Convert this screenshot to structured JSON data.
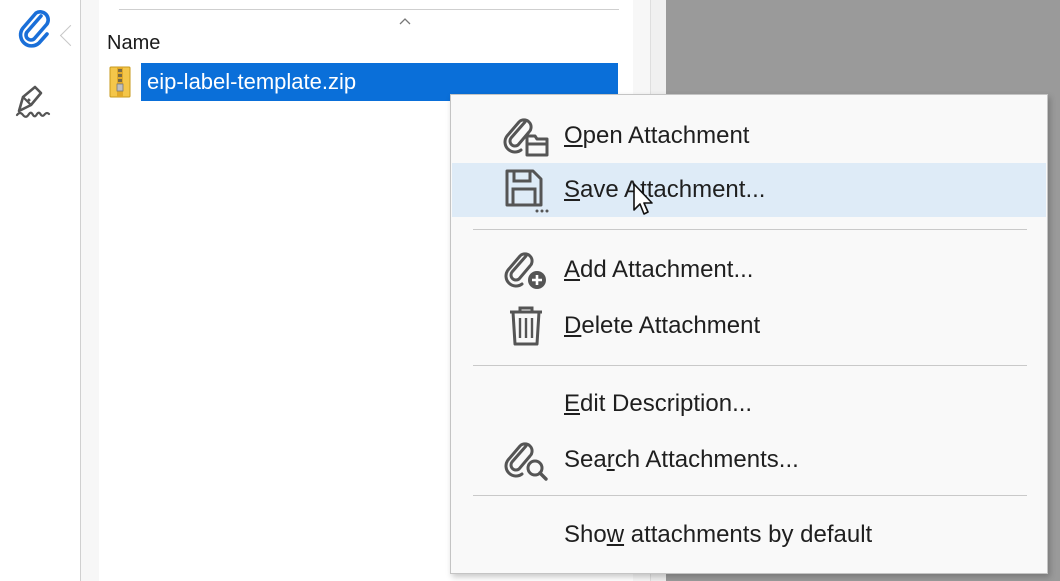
{
  "rail": {
    "items": [
      {
        "id": "attachments",
        "icon": "paperclip-icon",
        "active": true
      },
      {
        "id": "signatures",
        "icon": "pen-signature-icon",
        "active": false
      }
    ]
  },
  "list": {
    "column_name": "Name",
    "sort_indicator": "ascending",
    "rows": [
      {
        "filename": "eip-label-template.zip",
        "icon": "zip-file-icon",
        "selected": true
      }
    ]
  },
  "context_menu": {
    "items": [
      {
        "id": "open",
        "prefix": "",
        "mnemonic": "O",
        "rest": "pen Attachment",
        "icon": "paperclip-open-icon"
      },
      {
        "id": "save",
        "prefix": "",
        "mnemonic": "S",
        "rest": "ave Attachment...",
        "icon": "floppy-save-icon",
        "hovered": true
      },
      {
        "id": "add",
        "prefix": "",
        "mnemonic": "A",
        "rest": "dd Attachment...",
        "icon": "paperclip-add-icon"
      },
      {
        "id": "delete",
        "prefix": "",
        "mnemonic": "D",
        "rest": "elete Attachment",
        "icon": "trash-icon"
      },
      {
        "id": "edit",
        "prefix": "",
        "mnemonic": "E",
        "rest": "dit Description...",
        "icon": ""
      },
      {
        "id": "search",
        "prefix": "Sea",
        "mnemonic": "r",
        "rest": "ch Attachments...",
        "icon": "paperclip-search-icon"
      },
      {
        "id": "show",
        "prefix": "Sho",
        "mnemonic": "w",
        "rest": " attachments by default",
        "icon": ""
      }
    ]
  },
  "colors": {
    "selection": "#0a6fd9",
    "hover": "#deebf7",
    "rail_icon": "#1a6fd8",
    "menu_icon": "#555555"
  }
}
